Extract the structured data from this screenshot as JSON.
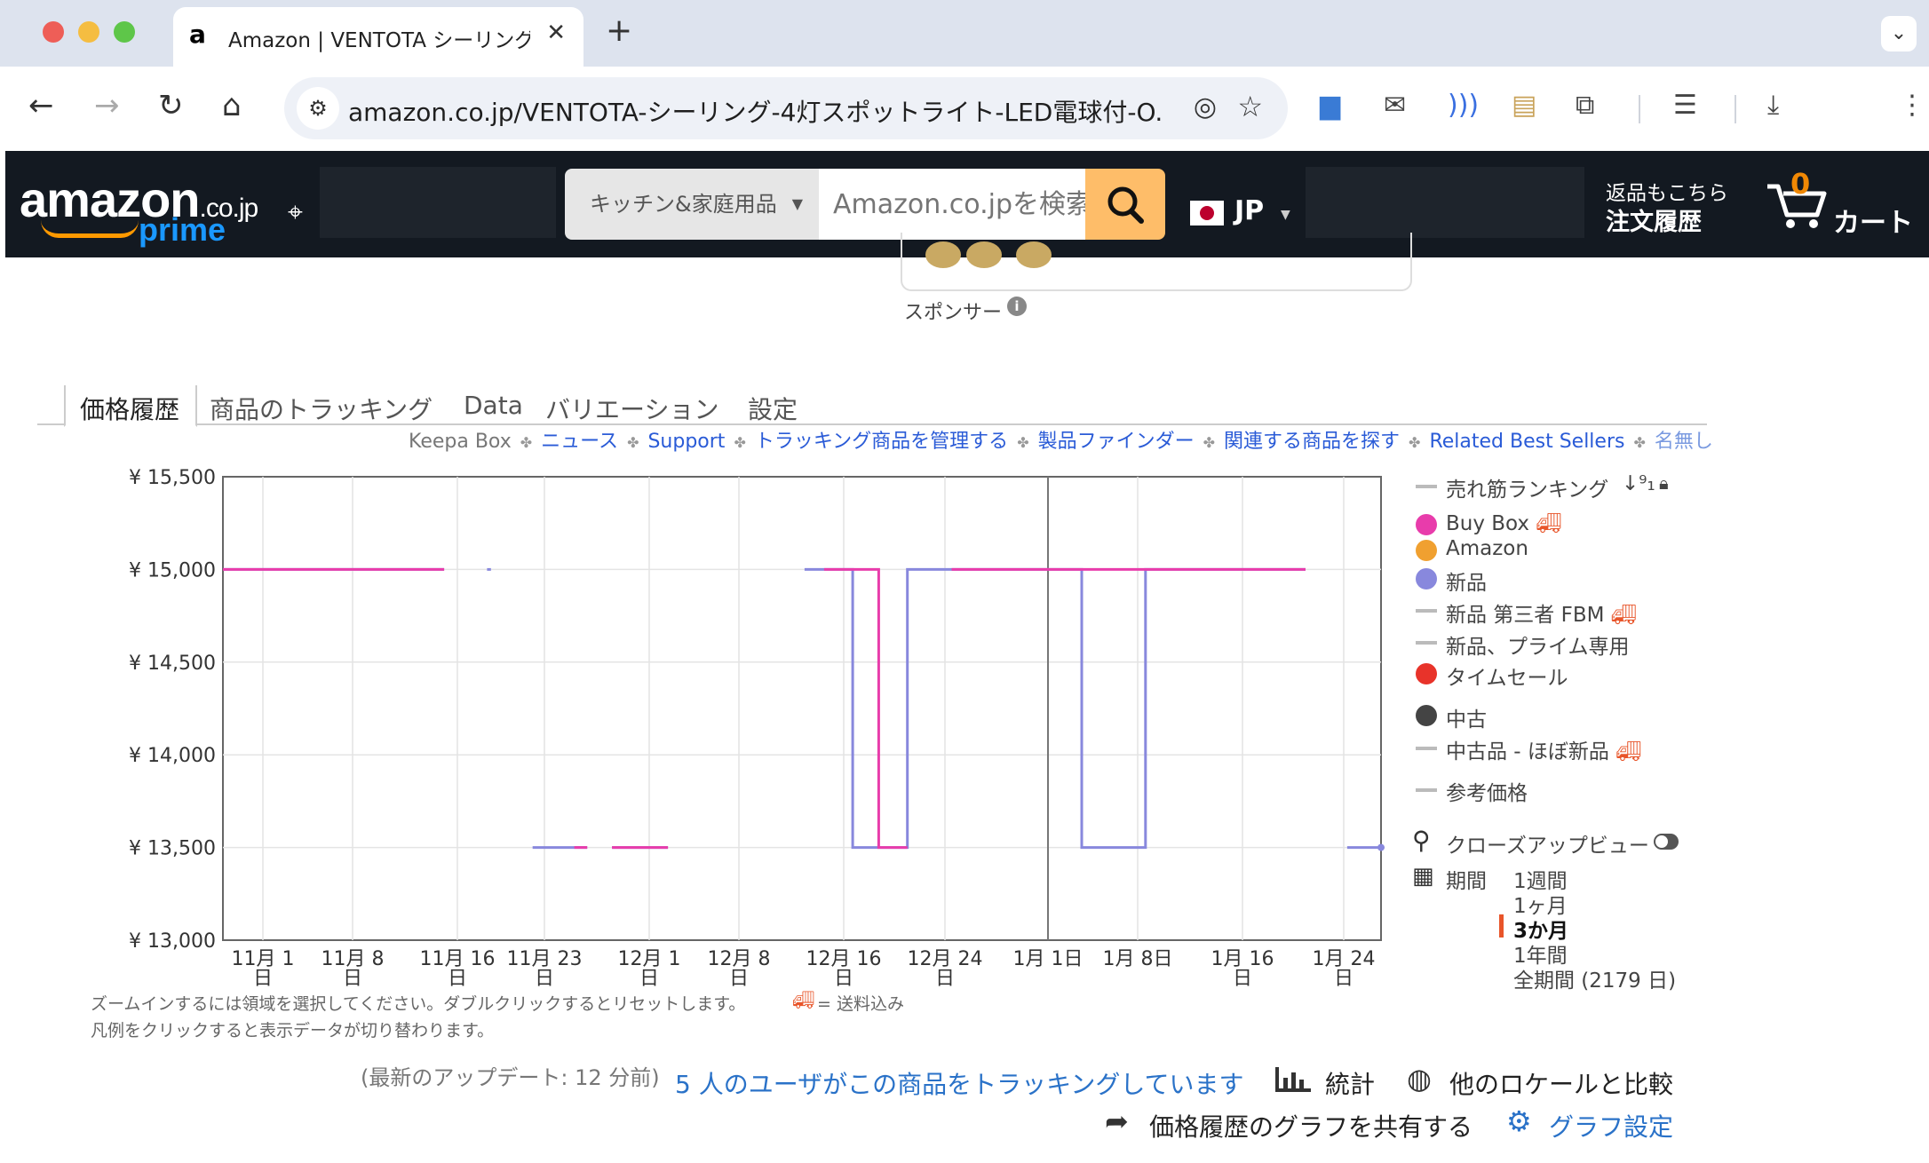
{
  "browser": {
    "tab_title": "Amazon | VENTOTA シーリング",
    "tab_close": "✕",
    "new_tab": "+",
    "url": "amazon.co.jp/VENTOTA-シーリング-4灯スポットライト-LED電球付-O..."
  },
  "amazon": {
    "logo": "amazon",
    "logo_suffix": ".co.jp",
    "prime": "prime",
    "search_category": "キッチン&家庭用品",
    "search_placeholder": "Amazon.co.jpを検索",
    "lang": "JP",
    "returns": "返品もこちら",
    "orders": "注文履歴",
    "cart_count": "0",
    "cart_label": "カート"
  },
  "sponsor": {
    "label": "スポンサー"
  },
  "keepa": {
    "tabs": [
      "価格履歴",
      "商品のトラッキング",
      "Data",
      "バリエーション",
      "設定"
    ],
    "links": [
      "Keepa Box",
      "ニュース",
      "Support",
      "トラッキング商品を管理する",
      "製品ファインダー",
      "関連する商品を探す",
      "Related Best Sellers",
      "名無し"
    ],
    "legend": {
      "sales_rank": "売れ筋ランキング",
      "buy_box": "Buy Box",
      "amazon": "Amazon",
      "new": "新品",
      "new_fbm": "新品 第三者 FBM",
      "new_prime": "新品、プライム専用",
      "lightning": "タイムセール",
      "used": "中古",
      "used_like_new": "中古品 - ほぼ新品",
      "reference": "参考価格",
      "closeup": "クローズアップビュー",
      "period": "期間",
      "periods": [
        "1週間",
        "1ヶ月",
        "3か月",
        "1年間",
        "全期間 (2179 日)"
      ],
      "selected_period": "3か月"
    },
    "hint1": "ズームインするには領域を選択してください。ダブルクリックするとリセットします。",
    "shipping_note": "= 送料込み",
    "hint2": "凡例をクリックすると表示データが切り替わります。",
    "last_update": "(最新のアップデート: 12 分前)",
    "tracking": "5 人のユーザがこの商品をトラッキングしています",
    "stats": "統計",
    "compare": "他のロケールと比較",
    "share": "価格履歴のグラフを共有する",
    "graph_settings": "グラフ設定"
  },
  "colors": {
    "buy_box": "#e83cab",
    "amazon": "#f0a030",
    "new": "#8888dd",
    "lightning": "#e8332a",
    "used": "#444444"
  },
  "chart_data": {
    "type": "line",
    "yticks": [
      "¥ 15,500",
      "¥ 15,000",
      "¥ 14,500",
      "¥ 14,000",
      "¥ 13,500",
      "¥ 13,000"
    ],
    "ylim": [
      13000,
      15500
    ],
    "xticks": [
      [
        "11月 1",
        "日"
      ],
      [
        "11月 8",
        "日"
      ],
      [
        "11月 16",
        "日"
      ],
      [
        "11月 23",
        "日"
      ],
      [
        "12月 1",
        "日"
      ],
      [
        "12月 8",
        "日"
      ],
      [
        "12月 16",
        "日"
      ],
      [
        "12月 24",
        "日"
      ],
      [
        "1月 1日",
        ""
      ],
      [
        "1月 8日",
        ""
      ],
      [
        "1月 16",
        "日"
      ],
      [
        "1月 24",
        "日"
      ]
    ],
    "x_range_days": [
      0,
      89
    ],
    "series": [
      {
        "name": "新品",
        "color": "#8888dd",
        "segments": [
          [
            [
              0,
              15000
            ],
            [
              17,
              15000
            ]
          ],
          [
            [
              20.3,
              15000
            ],
            [
              20.6,
              15000
            ]
          ],
          [
            [
              23.8,
              13500
            ],
            [
              28,
              13500
            ]
          ],
          [
            [
              29.9,
              13500
            ],
            [
              34.2,
              13500
            ]
          ],
          [
            [
              44.7,
              15000
            ],
            [
              48.4,
              15000
            ],
            [
              48.4,
              13500
            ],
            [
              52.6,
              13500
            ],
            [
              52.6,
              15000
            ],
            [
              56,
              15000
            ],
            [
              66,
              15000
            ],
            [
              66,
              13500
            ],
            [
              70.9,
              13500
            ],
            [
              70.9,
              15000
            ],
            [
              83.2,
              15000
            ]
          ],
          [
            [
              86.4,
              13500
            ],
            [
              89,
              13500
            ]
          ]
        ]
      },
      {
        "name": "Buy Box",
        "color": "#e83cab",
        "segments": [
          [
            [
              0,
              15000
            ],
            [
              17,
              15000
            ]
          ],
          [
            [
              27,
              13500
            ],
            [
              28,
              13500
            ]
          ],
          [
            [
              29.9,
              13500
            ],
            [
              34.2,
              13500
            ]
          ],
          [
            [
              46.2,
              15000
            ],
            [
              50.4,
              15000
            ],
            [
              50.4,
              13500
            ],
            [
              52.6,
              13500
            ]
          ],
          [
            [
              56,
              15000
            ],
            [
              83.2,
              15000
            ]
          ]
        ]
      }
    ]
  }
}
